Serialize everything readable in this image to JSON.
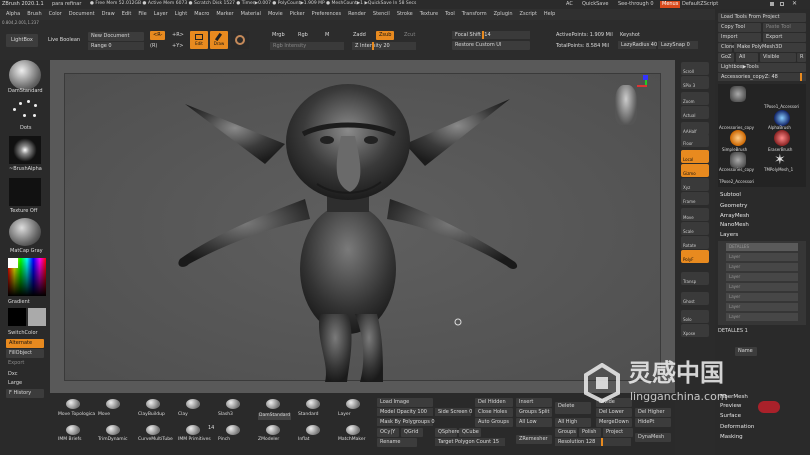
{
  "titlebar": {
    "app": "ZBrush 2020.1.1",
    "project": "para refinar",
    "stats": "● Free Mem 52.012GB ● Active Mem 6073 ● Scratch Disk 1527 ● Timer▶0.007 ● PolyCount▶1.909 MP ● MeshCount▶1 ▶QuickSave In 58 Secs",
    "ac": "AC",
    "quicksave": "QuickSave",
    "seethrough": "See-through  0",
    "menus": "Menus",
    "script": "DefaultZScript"
  },
  "menubar": {
    "items": [
      "Alpha",
      "Brush",
      "Color",
      "Document",
      "Draw",
      "Edit",
      "File",
      "Layer",
      "Light",
      "Macro",
      "Marker",
      "Material",
      "Movie",
      "Picker",
      "Preferences",
      "Render",
      "Stencil",
      "Stroke",
      "Texture",
      "Tool",
      "Transform",
      "Zplugin",
      "Zscript",
      "Help"
    ],
    "version": "0.804,2.001,1.237"
  },
  "toolbar": {
    "lightbox": "LightBox",
    "live_boolean": "Live Boolean",
    "new_document": "New Document",
    "range": "Range 0",
    "r_minus": "<R-",
    "r_plus": "+R>",
    "y_minus": "<Y-",
    "y_plus": "+Y>",
    "r_label": "(R)",
    "edit": "Edit",
    "draw": "Draw",
    "mrgb": "Mrgb",
    "rgb": "Rgb",
    "m": "M",
    "rgb_intensity": "Rgb Intensity",
    "zadd": "Zadd",
    "zsub": "Zsub",
    "zcut": "Zcut",
    "z_intensity": "Z Intensity 20",
    "focal_shift": "Focal Shift -14",
    "restore_custom_ui": "Restore Custom UI",
    "active_points": "ActivePoints: 1.909 Mil",
    "total_points": "TotalPoints: 8.584 Mil",
    "keyshot": "Keyshot",
    "lazy_radius": "LazyRadius 40",
    "lazy_snap": "LazySnap 0"
  },
  "left_shelf": {
    "brush": "DamStandard",
    "stroke": "Dots",
    "alpha": "~BrushAlpha",
    "texture": "Texture Off",
    "material": "MatCap Gray",
    "gradient": "Gradient",
    "switch_color": "SwitchColor",
    "alternate": "Alternate",
    "fill_object": "FillObject",
    "export": "Export",
    "dxc": "Dxc",
    "large": "Large",
    "f_history": "F History"
  },
  "right_shelf": {
    "items": [
      "Scroll",
      "SPix 3",
      "Zoom",
      "Actual",
      "AAHalf",
      "Floor",
      "Local",
      "Gizmo",
      "Xyz",
      "Frame",
      "Move",
      "Scale",
      "Rotate",
      "PolyF",
      "Transp",
      "Ghost",
      "Solo",
      "Xpose"
    ]
  },
  "right_panel": {
    "load_tools": "Load Tools From Project",
    "copy_tool": "Copy Tool",
    "paste_tool": "Paste Tool",
    "import": "Import",
    "export": "Export",
    "clone": "Clone",
    "make_polymesh": "Make PolyMesh3D",
    "goz": "GoZ",
    "all": "All",
    "visible": "Visible",
    "r": "R",
    "lightbox_tools": "Lightbox▶Tools",
    "current_tool": "Accessories_copyZ: 48",
    "tools": [
      "Accessories_copy",
      "TPose1_Accessori",
      "AlphaBrush",
      "SimpleBrush",
      "EraserBrush",
      "Accessories_copy",
      "TMPolyMesh_1",
      "TPose2_Accessori"
    ],
    "subtool": "Subtool",
    "geometry": "Geometry",
    "arraymesh": "ArrayMesh",
    "nanomesh": "NanoMesh",
    "layers": "Layers",
    "layer_rows": [
      "DETALLES",
      "Layer",
      "Layer",
      "Layer",
      "Layer",
      "Layer",
      "Layer",
      "Layer"
    ],
    "detalles": "DETALLES 1",
    "name": "Name",
    "fibermesh": "FiberMesh",
    "preview": "Preview",
    "surface": "Surface",
    "deformation": "Deformation",
    "masking": "Masking"
  },
  "brushes": {
    "row1": [
      "Move Topologica",
      "Move",
      "ClayBuildup",
      "Clay",
      "Slash3",
      "DamStandard",
      "Standard",
      "Layer"
    ],
    "row2": [
      "IMM Briefs",
      "TrimDynamic",
      "CurveMultiTube",
      "IMM Primitives",
      "Pinch",
      "ZModeler",
      "Inflat",
      "MatchMaker"
    ],
    "count": "14"
  },
  "bottom": {
    "load_image": "Load Image",
    "model_opacity": "Model Opacity 100",
    "mask_by_polygroups": "Mask By Polygroups 0",
    "ocly": "OCy|Y",
    "qgrid": "QGrid",
    "qsphere": "QSphere",
    "qcube": "QCube",
    "rename": "Rename",
    "side_screen": "Side Screen 0",
    "del_hidden": "Del Hidden",
    "close_holes": "Close Holes",
    "auto_groups": "Auto Groups",
    "target_polygon_count": "Target Polygon Count 15",
    "insert": "Insert",
    "groups_split": "Groups Split",
    "all_low": "All Low",
    "all_high": "All High",
    "groups": "Groups",
    "polish": "Polish",
    "delete": "Delete",
    "del_lower": "Del Lower",
    "del_higher": "Del Higher",
    "merge_down": "MergeDown",
    "divide": "Divide",
    "project": "Project",
    "hide_pt": "HidePt",
    "zremesher": "ZRemesher",
    "resolution": "Resolution 128",
    "dynamesh": "DynaMesh"
  },
  "watermark": {
    "cn": "灵感中国",
    "url": "lingganchina.com"
  },
  "colors": {
    "accent": "#e88a1f",
    "bg": "#2a2a2a",
    "viewport": "#595959"
  }
}
